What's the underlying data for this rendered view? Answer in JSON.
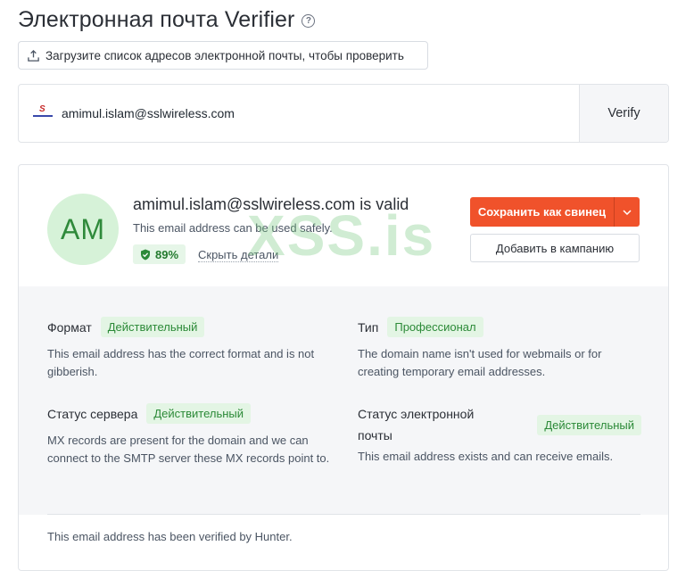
{
  "page": {
    "title": "Электронная почта Verifier",
    "help_icon": "question-circle-icon"
  },
  "upload": {
    "label": "Загрузите список адресов электронной почты, чтобы проверить",
    "icon": "upload-icon"
  },
  "verify": {
    "input_value": "amimul.islam@sslwireless.com",
    "button_label": "Verify",
    "logo_icon": "domain-logo-icon"
  },
  "result": {
    "avatar_initials": "AM",
    "headline": "amimul.islam@sslwireless.com is valid",
    "subtitle": "This email address can be used safely.",
    "score": "89%",
    "score_icon": "shield-check-icon",
    "hide_details": "Скрыть детали",
    "save_button": "Сохранить как свинец",
    "save_dropdown_icon": "chevron-down-icon",
    "campaign_button": "Добавить в кампанию",
    "watermark": "XSS.is"
  },
  "details": {
    "format": {
      "label": "Формат",
      "status": "Действительный",
      "description": "This email address has the correct format and is not gibberish."
    },
    "type": {
      "label": "Тип",
      "status": "Профессионал",
      "description": "The domain name isn't used for webmails or for creating temporary email addresses."
    },
    "server_status": {
      "label": "Статус сервера",
      "status": "Действительный",
      "description": "MX records are present for the domain and we can connect to the SMTP server these MX records point to."
    },
    "email_status": {
      "label": "Статус электронной почты",
      "status": "Действительный",
      "description": "This email address exists and can receive emails."
    }
  },
  "footer": {
    "note": "This email address has been verified by Hunter."
  },
  "colors": {
    "accent": "#f0522b",
    "valid_green": "#2c8a38",
    "avatar_bg": "#d6f2d8"
  }
}
